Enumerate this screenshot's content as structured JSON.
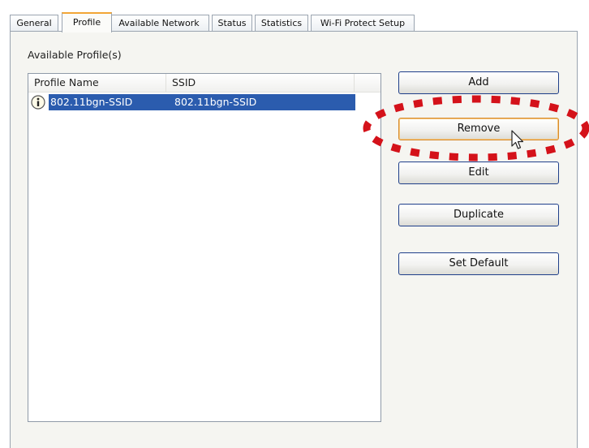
{
  "tabs": [
    {
      "label": "General"
    },
    {
      "label": "Profile"
    },
    {
      "label": "Available Network"
    },
    {
      "label": "Status"
    },
    {
      "label": "Statistics"
    },
    {
      "label": "Wi-Fi Protect Setup"
    }
  ],
  "active_tab": "Profile",
  "profiles_group": {
    "title": "Available Profile(s)",
    "columns": [
      "Profile Name",
      "SSID"
    ],
    "rows": [
      {
        "profile_name": "802.11bgn-SSID",
        "ssid": "802.11bgn-SSID",
        "icon": "info-icon",
        "selected": true
      }
    ]
  },
  "actions": {
    "add": "Add",
    "remove": "Remove",
    "edit": "Edit",
    "duplicate": "Duplicate",
    "set_default": "Set Default"
  },
  "colors": {
    "selection": "#2b5cae",
    "active_tab_accent": "#f2a535",
    "annotation_ring": "#d4121a"
  }
}
